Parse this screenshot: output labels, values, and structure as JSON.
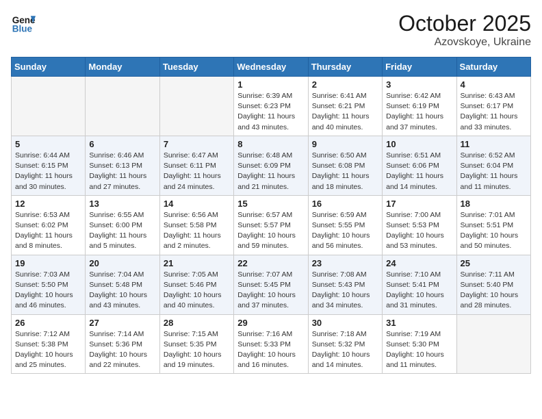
{
  "header": {
    "logo_line1": "General",
    "logo_line2": "Blue",
    "month": "October 2025",
    "location": "Azovskoye, Ukraine"
  },
  "weekdays": [
    "Sunday",
    "Monday",
    "Tuesday",
    "Wednesday",
    "Thursday",
    "Friday",
    "Saturday"
  ],
  "weeks": [
    [
      {
        "day": "",
        "info": ""
      },
      {
        "day": "",
        "info": ""
      },
      {
        "day": "",
        "info": ""
      },
      {
        "day": "1",
        "info": "Sunrise: 6:39 AM\nSunset: 6:23 PM\nDaylight: 11 hours\nand 43 minutes."
      },
      {
        "day": "2",
        "info": "Sunrise: 6:41 AM\nSunset: 6:21 PM\nDaylight: 11 hours\nand 40 minutes."
      },
      {
        "day": "3",
        "info": "Sunrise: 6:42 AM\nSunset: 6:19 PM\nDaylight: 11 hours\nand 37 minutes."
      },
      {
        "day": "4",
        "info": "Sunrise: 6:43 AM\nSunset: 6:17 PM\nDaylight: 11 hours\nand 33 minutes."
      }
    ],
    [
      {
        "day": "5",
        "info": "Sunrise: 6:44 AM\nSunset: 6:15 PM\nDaylight: 11 hours\nand 30 minutes."
      },
      {
        "day": "6",
        "info": "Sunrise: 6:46 AM\nSunset: 6:13 PM\nDaylight: 11 hours\nand 27 minutes."
      },
      {
        "day": "7",
        "info": "Sunrise: 6:47 AM\nSunset: 6:11 PM\nDaylight: 11 hours\nand 24 minutes."
      },
      {
        "day": "8",
        "info": "Sunrise: 6:48 AM\nSunset: 6:09 PM\nDaylight: 11 hours\nand 21 minutes."
      },
      {
        "day": "9",
        "info": "Sunrise: 6:50 AM\nSunset: 6:08 PM\nDaylight: 11 hours\nand 18 minutes."
      },
      {
        "day": "10",
        "info": "Sunrise: 6:51 AM\nSunset: 6:06 PM\nDaylight: 11 hours\nand 14 minutes."
      },
      {
        "day": "11",
        "info": "Sunrise: 6:52 AM\nSunset: 6:04 PM\nDaylight: 11 hours\nand 11 minutes."
      }
    ],
    [
      {
        "day": "12",
        "info": "Sunrise: 6:53 AM\nSunset: 6:02 PM\nDaylight: 11 hours\nand 8 minutes."
      },
      {
        "day": "13",
        "info": "Sunrise: 6:55 AM\nSunset: 6:00 PM\nDaylight: 11 hours\nand 5 minutes."
      },
      {
        "day": "14",
        "info": "Sunrise: 6:56 AM\nSunset: 5:58 PM\nDaylight: 11 hours\nand 2 minutes."
      },
      {
        "day": "15",
        "info": "Sunrise: 6:57 AM\nSunset: 5:57 PM\nDaylight: 10 hours\nand 59 minutes."
      },
      {
        "day": "16",
        "info": "Sunrise: 6:59 AM\nSunset: 5:55 PM\nDaylight: 10 hours\nand 56 minutes."
      },
      {
        "day": "17",
        "info": "Sunrise: 7:00 AM\nSunset: 5:53 PM\nDaylight: 10 hours\nand 53 minutes."
      },
      {
        "day": "18",
        "info": "Sunrise: 7:01 AM\nSunset: 5:51 PM\nDaylight: 10 hours\nand 50 minutes."
      }
    ],
    [
      {
        "day": "19",
        "info": "Sunrise: 7:03 AM\nSunset: 5:50 PM\nDaylight: 10 hours\nand 46 minutes."
      },
      {
        "day": "20",
        "info": "Sunrise: 7:04 AM\nSunset: 5:48 PM\nDaylight: 10 hours\nand 43 minutes."
      },
      {
        "day": "21",
        "info": "Sunrise: 7:05 AM\nSunset: 5:46 PM\nDaylight: 10 hours\nand 40 minutes."
      },
      {
        "day": "22",
        "info": "Sunrise: 7:07 AM\nSunset: 5:45 PM\nDaylight: 10 hours\nand 37 minutes."
      },
      {
        "day": "23",
        "info": "Sunrise: 7:08 AM\nSunset: 5:43 PM\nDaylight: 10 hours\nand 34 minutes."
      },
      {
        "day": "24",
        "info": "Sunrise: 7:10 AM\nSunset: 5:41 PM\nDaylight: 10 hours\nand 31 minutes."
      },
      {
        "day": "25",
        "info": "Sunrise: 7:11 AM\nSunset: 5:40 PM\nDaylight: 10 hours\nand 28 minutes."
      }
    ],
    [
      {
        "day": "26",
        "info": "Sunrise: 7:12 AM\nSunset: 5:38 PM\nDaylight: 10 hours\nand 25 minutes."
      },
      {
        "day": "27",
        "info": "Sunrise: 7:14 AM\nSunset: 5:36 PM\nDaylight: 10 hours\nand 22 minutes."
      },
      {
        "day": "28",
        "info": "Sunrise: 7:15 AM\nSunset: 5:35 PM\nDaylight: 10 hours\nand 19 minutes."
      },
      {
        "day": "29",
        "info": "Sunrise: 7:16 AM\nSunset: 5:33 PM\nDaylight: 10 hours\nand 16 minutes."
      },
      {
        "day": "30",
        "info": "Sunrise: 7:18 AM\nSunset: 5:32 PM\nDaylight: 10 hours\nand 14 minutes."
      },
      {
        "day": "31",
        "info": "Sunrise: 7:19 AM\nSunset: 5:30 PM\nDaylight: 10 hours\nand 11 minutes."
      },
      {
        "day": "",
        "info": ""
      }
    ]
  ]
}
